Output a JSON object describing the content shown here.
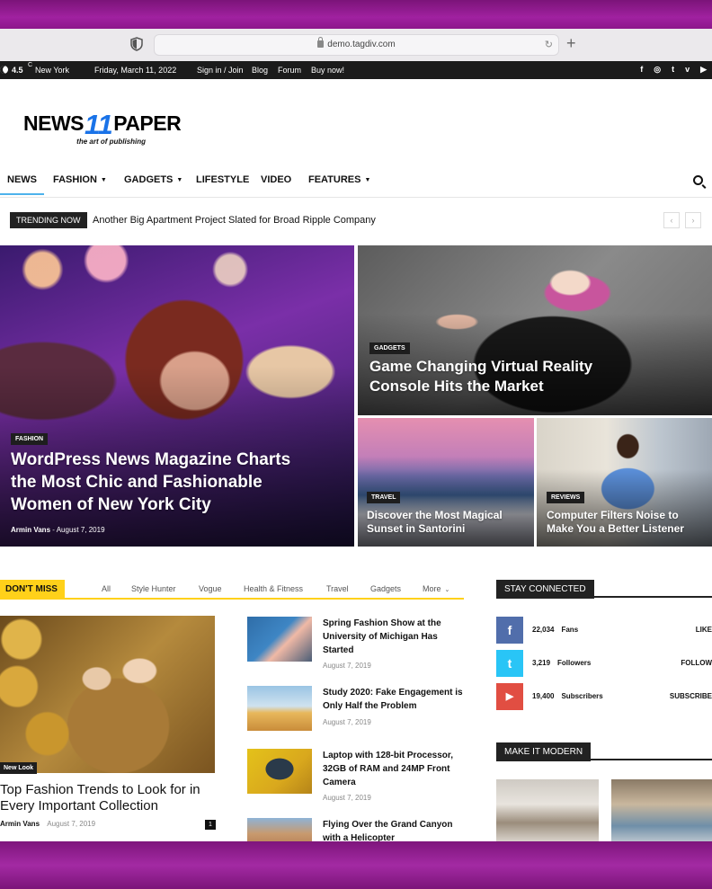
{
  "browser": {
    "url": "demo.tagdiv.com"
  },
  "topbar": {
    "temperature": "4.5",
    "unit": "C",
    "city": "New York",
    "date": "Friday, March 11, 2022",
    "links": [
      "Sign in / Join",
      "Blog",
      "Forum",
      "Buy now!"
    ],
    "social_icons": [
      "facebook-icon",
      "instagram-icon",
      "twitter-icon",
      "vimeo-icon",
      "youtube-icon"
    ]
  },
  "logo": {
    "part1": "NEWS",
    "number": "11",
    "part2": "PAPER",
    "tagline": "the art of publishing"
  },
  "nav": {
    "items": [
      {
        "label": "NEWS",
        "dropdown": false
      },
      {
        "label": "FASHION",
        "dropdown": true
      },
      {
        "label": "GADGETS",
        "dropdown": true
      },
      {
        "label": "LIFESTYLE",
        "dropdown": false
      },
      {
        "label": "VIDEO",
        "dropdown": false
      },
      {
        "label": "FEATURES",
        "dropdown": true
      }
    ],
    "accent_color": "#4db2ec"
  },
  "trending": {
    "label": "TRENDING NOW",
    "headline": "Another Big Apartment Project Slated for Broad Ripple Company"
  },
  "featured": [
    {
      "category": "FASHION",
      "title": "WordPress News Magazine Charts the Most Chic and Fashionable Women of New York City",
      "author": "Armin Vans",
      "date": "August 7, 2019"
    },
    {
      "category": "GADGETS",
      "title": "Game Changing Virtual Reality Console Hits the Market"
    },
    {
      "category": "TRAVEL",
      "title": "Discover the Most Magical Sunset in Santorini"
    },
    {
      "category": "REVIEWS",
      "title": "Computer Filters Noise to Make You a Better Listener"
    }
  ],
  "dont_miss": {
    "label": "DON'T MISS",
    "tabs": [
      "All",
      "Style Hunter",
      "Vogue",
      "Health & Fitness",
      "Travel",
      "Gadgets",
      "More"
    ],
    "accent_color": "#ffd11a",
    "main": {
      "badge": "New Look",
      "title": "Top Fashion Trends to Look for in Every Important Collection",
      "author": "Armin Vans",
      "date": "August 7, 2019",
      "comments": "1"
    },
    "list": [
      {
        "title": "Spring Fashion Show at the University of Michigan Has Started",
        "date": "August 7, 2019"
      },
      {
        "title": "Study 2020: Fake Engagement is Only Half the Problem",
        "date": "August 7, 2019"
      },
      {
        "title": "Laptop with 128-bit Processor, 32GB of RAM and 24MP Front Camera",
        "date": "August 7, 2019"
      },
      {
        "title": "Flying Over the Grand Canyon with a Helicopter",
        "date": ""
      }
    ]
  },
  "stay_connected": {
    "label": "STAY CONNECTED",
    "rows": [
      {
        "icon": "facebook-icon",
        "glyph": "f",
        "count": "22,034",
        "unit": "Fans",
        "action": "LIKE",
        "color": "#516eab"
      },
      {
        "icon": "twitter-icon",
        "glyph": "t",
        "count": "3,219",
        "unit": "Followers",
        "action": "FOLLOW",
        "color": "#29c5f6"
      },
      {
        "icon": "youtube-icon",
        "glyph": "▶",
        "count": "19,400",
        "unit": "Subscribers",
        "action": "SUBSCRIBE",
        "color": "#e14e42"
      }
    ]
  },
  "make_it_modern": {
    "label": "MAKE IT MODERN"
  }
}
